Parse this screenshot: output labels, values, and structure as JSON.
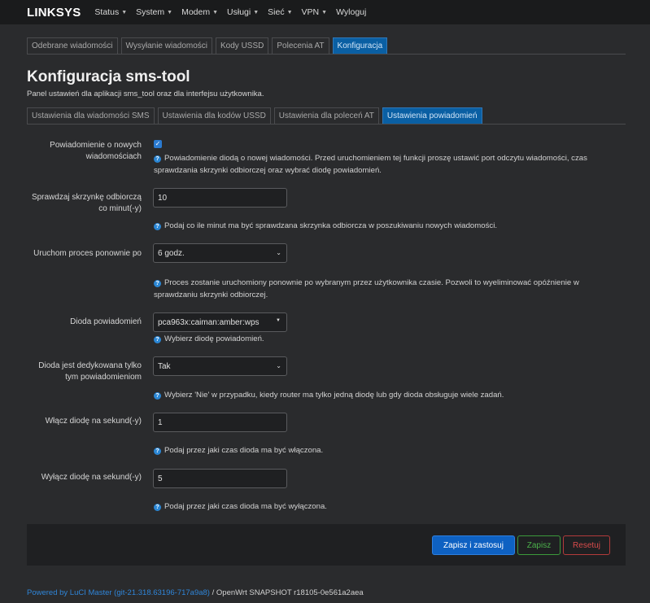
{
  "nav": {
    "brand": "LINKSYS",
    "menu": [
      {
        "label": "Status"
      },
      {
        "label": "System"
      },
      {
        "label": "Modem"
      },
      {
        "label": "Usługi"
      },
      {
        "label": "Sieć"
      },
      {
        "label": "VPN"
      },
      {
        "label": "Wyloguj"
      }
    ]
  },
  "top_tabs": [
    {
      "label": "Odebrane wiadomości",
      "active": false
    },
    {
      "label": "Wysyłanie wiadomości",
      "active": false
    },
    {
      "label": "Kody USSD",
      "active": false
    },
    {
      "label": "Polecenia AT",
      "active": false
    },
    {
      "label": "Konfiguracja",
      "active": true
    }
  ],
  "page": {
    "title": "Konfiguracja sms-tool",
    "description": "Panel ustawień dla aplikacji sms_tool oraz dla interfejsu użytkownika."
  },
  "sub_tabs": [
    {
      "label": "Ustawienia dla wiadomości SMS",
      "active": false
    },
    {
      "label": "Ustawienia dla kodów USSD",
      "active": false
    },
    {
      "label": "Ustawienia dla poleceń AT",
      "active": false
    },
    {
      "label": "Ustawienia powiadomień",
      "active": true
    }
  ],
  "form": {
    "notify": {
      "label": "Powiadomienie o nowych wiadomościach",
      "checked": true,
      "help": "Powiadomienie diodą o nowej wiadomości. Przed uruchomieniem tej funkcji proszę ustawić port odczytu wiadomości, czas sprawdzania skrzynki odbiorczej oraz wybrać diodę powiadomień."
    },
    "check_interval": {
      "label": "Sprawdzaj skrzynkę odbiorczą co minut(-y)",
      "value": "10",
      "help": "Podaj co ile minut ma być sprawdzana skrzynka odbiorcza w poszukiwaniu nowych wiadomości."
    },
    "restart": {
      "label": "Uruchom proces ponownie po",
      "value": "6 godz.",
      "help": "Proces zostanie uruchomiony ponownie po wybranym przez użytkownika czasie. Pozwoli to wyeliminować opóźnienie w sprawdzaniu skrzynki odbiorczej."
    },
    "led": {
      "label": "Dioda powiadomień",
      "value": "pca963x:caiman:amber:wps",
      "help": "Wybierz diodę powiadomień."
    },
    "led_dedicated": {
      "label": "Dioda jest dedykowana tylko tym powiadomieniom",
      "value": "Tak",
      "help": "Wybierz 'Nie' w przypadku, kiedy router ma tylko jedną diodę lub gdy dioda obsługuje wiele zadań."
    },
    "led_on": {
      "label": "Włącz diodę na sekund(-y)",
      "value": "1",
      "help": "Podaj przez jaki czas dioda ma być włączona."
    },
    "led_off": {
      "label": "Wyłącz diodę na sekund(-y)",
      "value": "5",
      "help": "Podaj przez jaki czas dioda ma być wyłączona."
    }
  },
  "buttons": {
    "apply": "Zapisz i zastosuj",
    "save": "Zapisz",
    "reset": "Resetuj"
  },
  "footer": {
    "powered_link": "Powered by LuCI Master (git-21.318.63196-717a9a8)",
    "powered_rest": " / OpenWrt SNAPSHOT r18105-0e561a2aea"
  },
  "colors": {
    "accent": "#0a5fa3",
    "save": "#3b9a3b",
    "reset": "#b33b3b"
  }
}
